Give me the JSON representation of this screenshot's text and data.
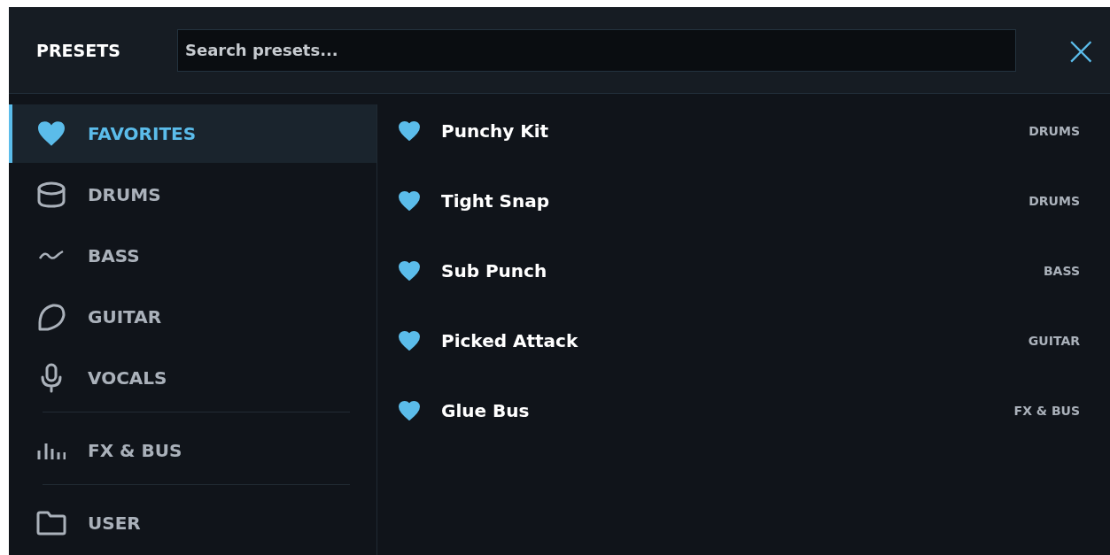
{
  "header": {
    "title": "PRESETS",
    "search": {
      "placeholder": "Search presets..."
    },
    "close": "×"
  },
  "sidebar": {
    "items": [
      {
        "label": "FAVORITES",
        "kind": "heart",
        "selected": true
      },
      {
        "label": "DRUMS",
        "kind": "drum",
        "selected": false
      },
      {
        "label": "BASS",
        "kind": "wave",
        "selected": false
      },
      {
        "label": "GUITAR",
        "kind": "pick",
        "selected": false
      },
      {
        "label": "VOCALS",
        "kind": "mic",
        "selected": false,
        "divider_after": true
      },
      {
        "label": "FX & BUS",
        "kind": "bars",
        "selected": false,
        "divider_after": true
      },
      {
        "label": "USER",
        "kind": "folder",
        "selected": false
      }
    ]
  },
  "presets": [
    {
      "name": "Punchy Kit",
      "category": "DRUMS",
      "favorite": true
    },
    {
      "name": "Tight Snap",
      "category": "DRUMS",
      "favorite": true
    },
    {
      "name": "Sub Punch",
      "category": "BASS",
      "favorite": true
    },
    {
      "name": "Picked Attack",
      "category": "GUITAR",
      "favorite": true
    },
    {
      "name": "Glue Bus",
      "category": "FX & BUS",
      "favorite": true
    }
  ]
}
